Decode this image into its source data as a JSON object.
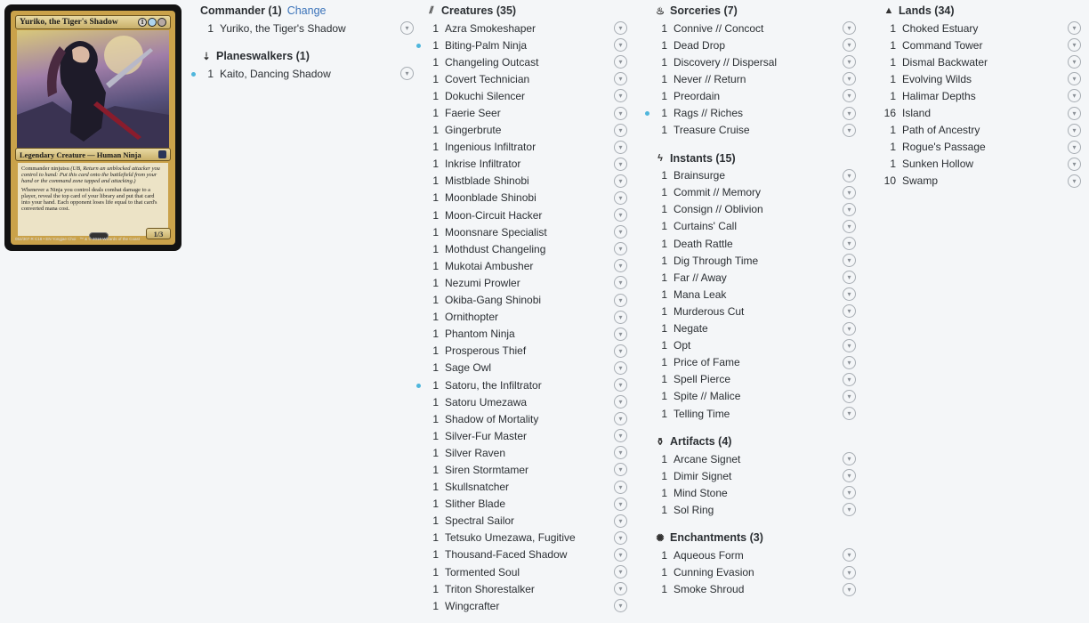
{
  "card": {
    "name": "Yuriko, the Tiger's Shadow",
    "mana_cost": [
      "1",
      "U",
      "B"
    ],
    "type_line": "Legendary Creature — Human Ninja",
    "rules_text_1": "Commander ninjutsu",
    "rules_text_1_reminder": "(UB, Return an unblocked attacker you control to hand: Put this card onto the battlefield from your hand or the command zone tapped and attacking.)",
    "rules_text_2": "Whenever a Ninja you control deals combat damage to a player, reveal the top card of your library and put that card into your hand. Each opponent loses life equal to that card's converted mana cost.",
    "pt": "1/3",
    "footer_left": "052/307 R\nC18 • EN",
    "footer_artist": "Yongjae Choi",
    "footer_right": "™ & © 2018 Wizards of the Coast"
  },
  "colors": {
    "accent": "#3b73b9",
    "new_dot": "#4fb6dc"
  },
  "columns": [
    {
      "sections": [
        {
          "id": "commander",
          "icon": "crown-icon",
          "glyph": "",
          "title": "Commander (1)",
          "action": "Change",
          "cards": [
            {
              "qty": "1",
              "name": "Yuriko, the Tiger's Shadow",
              "new": false
            }
          ]
        },
        {
          "id": "planeswalkers",
          "icon": "planeswalker-icon",
          "glyph": "⇣",
          "title": "Planeswalkers (1)",
          "cards": [
            {
              "qty": "1",
              "name": "Kaito, Dancing Shadow",
              "new": true
            }
          ]
        }
      ]
    },
    {
      "sections": [
        {
          "id": "creatures",
          "icon": "creature-claw-icon",
          "glyph": "⫽",
          "title": "Creatures (35)",
          "cards": [
            {
              "qty": "1",
              "name": "Azra Smokeshaper",
              "new": false
            },
            {
              "qty": "1",
              "name": "Biting-Palm Ninja",
              "new": true
            },
            {
              "qty": "1",
              "name": "Changeling Outcast",
              "new": false
            },
            {
              "qty": "1",
              "name": "Covert Technician",
              "new": false
            },
            {
              "qty": "1",
              "name": "Dokuchi Silencer",
              "new": false
            },
            {
              "qty": "1",
              "name": "Faerie Seer",
              "new": false
            },
            {
              "qty": "1",
              "name": "Gingerbrute",
              "new": false
            },
            {
              "qty": "1",
              "name": "Ingenious Infiltrator",
              "new": false
            },
            {
              "qty": "1",
              "name": "Inkrise Infiltrator",
              "new": false
            },
            {
              "qty": "1",
              "name": "Mistblade Shinobi",
              "new": false
            },
            {
              "qty": "1",
              "name": "Moonblade Shinobi",
              "new": false
            },
            {
              "qty": "1",
              "name": "Moon-Circuit Hacker",
              "new": false
            },
            {
              "qty": "1",
              "name": "Moonsnare Specialist",
              "new": false
            },
            {
              "qty": "1",
              "name": "Mothdust Changeling",
              "new": false
            },
            {
              "qty": "1",
              "name": "Mukotai Ambusher",
              "new": false
            },
            {
              "qty": "1",
              "name": "Nezumi Prowler",
              "new": false
            },
            {
              "qty": "1",
              "name": "Okiba-Gang Shinobi",
              "new": false
            },
            {
              "qty": "1",
              "name": "Ornithopter",
              "new": false
            },
            {
              "qty": "1",
              "name": "Phantom Ninja",
              "new": false
            },
            {
              "qty": "1",
              "name": "Prosperous Thief",
              "new": false
            },
            {
              "qty": "1",
              "name": "Sage Owl",
              "new": false
            },
            {
              "qty": "1",
              "name": "Satoru, the Infiltrator",
              "new": true
            },
            {
              "qty": "1",
              "name": "Satoru Umezawa",
              "new": false
            },
            {
              "qty": "1",
              "name": "Shadow of Mortality",
              "new": false
            },
            {
              "qty": "1",
              "name": "Silver-Fur Master",
              "new": false
            },
            {
              "qty": "1",
              "name": "Silver Raven",
              "new": false
            },
            {
              "qty": "1",
              "name": "Siren Stormtamer",
              "new": false
            },
            {
              "qty": "1",
              "name": "Skullsnatcher",
              "new": false
            },
            {
              "qty": "1",
              "name": "Slither Blade",
              "new": false
            },
            {
              "qty": "1",
              "name": "Spectral Sailor",
              "new": false
            },
            {
              "qty": "1",
              "name": "Tetsuko Umezawa, Fugitive",
              "new": false
            },
            {
              "qty": "1",
              "name": "Thousand-Faced Shadow",
              "new": false
            },
            {
              "qty": "1",
              "name": "Tormented Soul",
              "new": false
            },
            {
              "qty": "1",
              "name": "Triton Shorestalker",
              "new": false
            },
            {
              "qty": "1",
              "name": "Wingcrafter",
              "new": false
            }
          ]
        }
      ]
    },
    {
      "sections": [
        {
          "id": "sorceries",
          "icon": "sorcery-icon",
          "glyph": "♨",
          "title": "Sorceries (7)",
          "cards": [
            {
              "qty": "1",
              "name": "Connive // Concoct",
              "new": false
            },
            {
              "qty": "1",
              "name": "Dead Drop",
              "new": false
            },
            {
              "qty": "1",
              "name": "Discovery // Dispersal",
              "new": false
            },
            {
              "qty": "1",
              "name": "Never // Return",
              "new": false
            },
            {
              "qty": "1",
              "name": "Preordain",
              "new": false
            },
            {
              "qty": "1",
              "name": "Rags // Riches",
              "new": true
            },
            {
              "qty": "1",
              "name": "Treasure Cruise",
              "new": false
            }
          ]
        },
        {
          "id": "instants",
          "icon": "instant-lightning-icon",
          "glyph": "ϟ",
          "title": "Instants (15)",
          "cards": [
            {
              "qty": "1",
              "name": "Brainsurge",
              "new": false
            },
            {
              "qty": "1",
              "name": "Commit // Memory",
              "new": false
            },
            {
              "qty": "1",
              "name": "Consign // Oblivion",
              "new": false
            },
            {
              "qty": "1",
              "name": "Curtains' Call",
              "new": false
            },
            {
              "qty": "1",
              "name": "Death Rattle",
              "new": false
            },
            {
              "qty": "1",
              "name": "Dig Through Time",
              "new": false
            },
            {
              "qty": "1",
              "name": "Far // Away",
              "new": false
            },
            {
              "qty": "1",
              "name": "Mana Leak",
              "new": false
            },
            {
              "qty": "1",
              "name": "Murderous Cut",
              "new": false
            },
            {
              "qty": "1",
              "name": "Negate",
              "new": false
            },
            {
              "qty": "1",
              "name": "Opt",
              "new": false
            },
            {
              "qty": "1",
              "name": "Price of Fame",
              "new": false
            },
            {
              "qty": "1",
              "name": "Spell Pierce",
              "new": false
            },
            {
              "qty": "1",
              "name": "Spite // Malice",
              "new": false
            },
            {
              "qty": "1",
              "name": "Telling Time",
              "new": false
            }
          ]
        },
        {
          "id": "artifacts",
          "icon": "artifact-icon",
          "glyph": "⚱",
          "title": "Artifacts (4)",
          "cards": [
            {
              "qty": "1",
              "name": "Arcane Signet",
              "new": false
            },
            {
              "qty": "1",
              "name": "Dimir Signet",
              "new": false
            },
            {
              "qty": "1",
              "name": "Mind Stone",
              "new": false
            },
            {
              "qty": "1",
              "name": "Sol Ring",
              "new": false
            }
          ]
        },
        {
          "id": "enchantments",
          "icon": "enchantment-icon",
          "glyph": "✺",
          "title": "Enchantments (3)",
          "cards": [
            {
              "qty": "1",
              "name": "Aqueous Form",
              "new": false
            },
            {
              "qty": "1",
              "name": "Cunning Evasion",
              "new": false
            },
            {
              "qty": "1",
              "name": "Smoke Shroud",
              "new": false
            }
          ]
        }
      ]
    },
    {
      "sections": [
        {
          "id": "lands",
          "icon": "land-mountain-icon",
          "glyph": "▲",
          "title": "Lands (34)",
          "cards": [
            {
              "qty": "1",
              "name": "Choked Estuary",
              "new": false
            },
            {
              "qty": "1",
              "name": "Command Tower",
              "new": false
            },
            {
              "qty": "1",
              "name": "Dismal Backwater",
              "new": false
            },
            {
              "qty": "1",
              "name": "Evolving Wilds",
              "new": false
            },
            {
              "qty": "1",
              "name": "Halimar Depths",
              "new": false
            },
            {
              "qty": "16",
              "name": "Island",
              "new": false
            },
            {
              "qty": "1",
              "name": "Path of Ancestry",
              "new": false
            },
            {
              "qty": "1",
              "name": "Rogue's Passage",
              "new": false
            },
            {
              "qty": "1",
              "name": "Sunken Hollow",
              "new": false
            },
            {
              "qty": "10",
              "name": "Swamp",
              "new": false
            }
          ]
        }
      ]
    }
  ]
}
